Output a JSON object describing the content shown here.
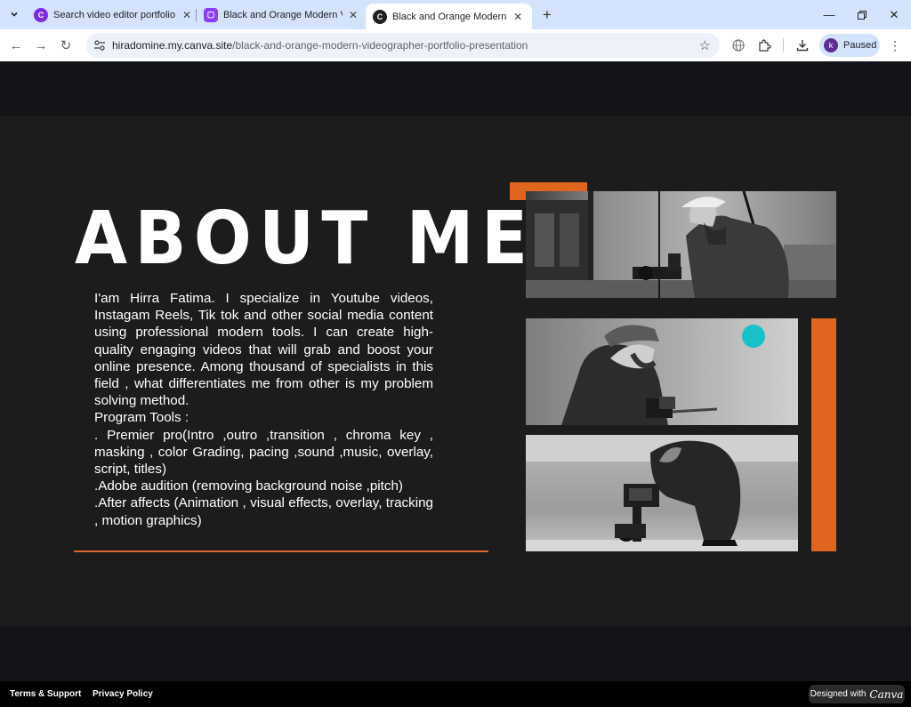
{
  "browser": {
    "tabs": [
      {
        "title": "Search video editor portfolio - C",
        "active": false
      },
      {
        "title": "Black and Orange Modern Vide",
        "active": false
      },
      {
        "title": "Black and Orange Modern Vide",
        "active": true
      }
    ],
    "url_host": "hiradomine.my.canva.site",
    "url_path": "/black-and-orange-modern-videographer-portfolio-presentation",
    "profile_initial": "k",
    "profile_status": "Paused"
  },
  "slide": {
    "heading": "ABOUT ME",
    "intro": "I'am Hirra Fatima. I specialize in Youtube videos, Instagam Reels, Tik tok and other social media content using professional  modern tools. I  can create high-quality engaging videos that will grab and boost your online presence. Among thousand of specialists in this field , what differentiates me from other is my problem solving  method.",
    "tools_heading": "Program Tools :",
    "tool_1": ". Premier pro(Intro ,outro ,transition , chroma key , masking , color Grading, pacing ,sound ,music, overlay, script, titles)",
    "tool_2": ".Adobe audition (removing background noise ,pitch)",
    "tool_3": ".After affects (Animation , visual effects, overlay, tracking , motion graphics)",
    "accent_color": "#e0651f"
  },
  "footer": {
    "terms": "Terms & Support",
    "privacy": "Privacy Policy",
    "designed_with": "Designed with",
    "brand": "Canva"
  }
}
